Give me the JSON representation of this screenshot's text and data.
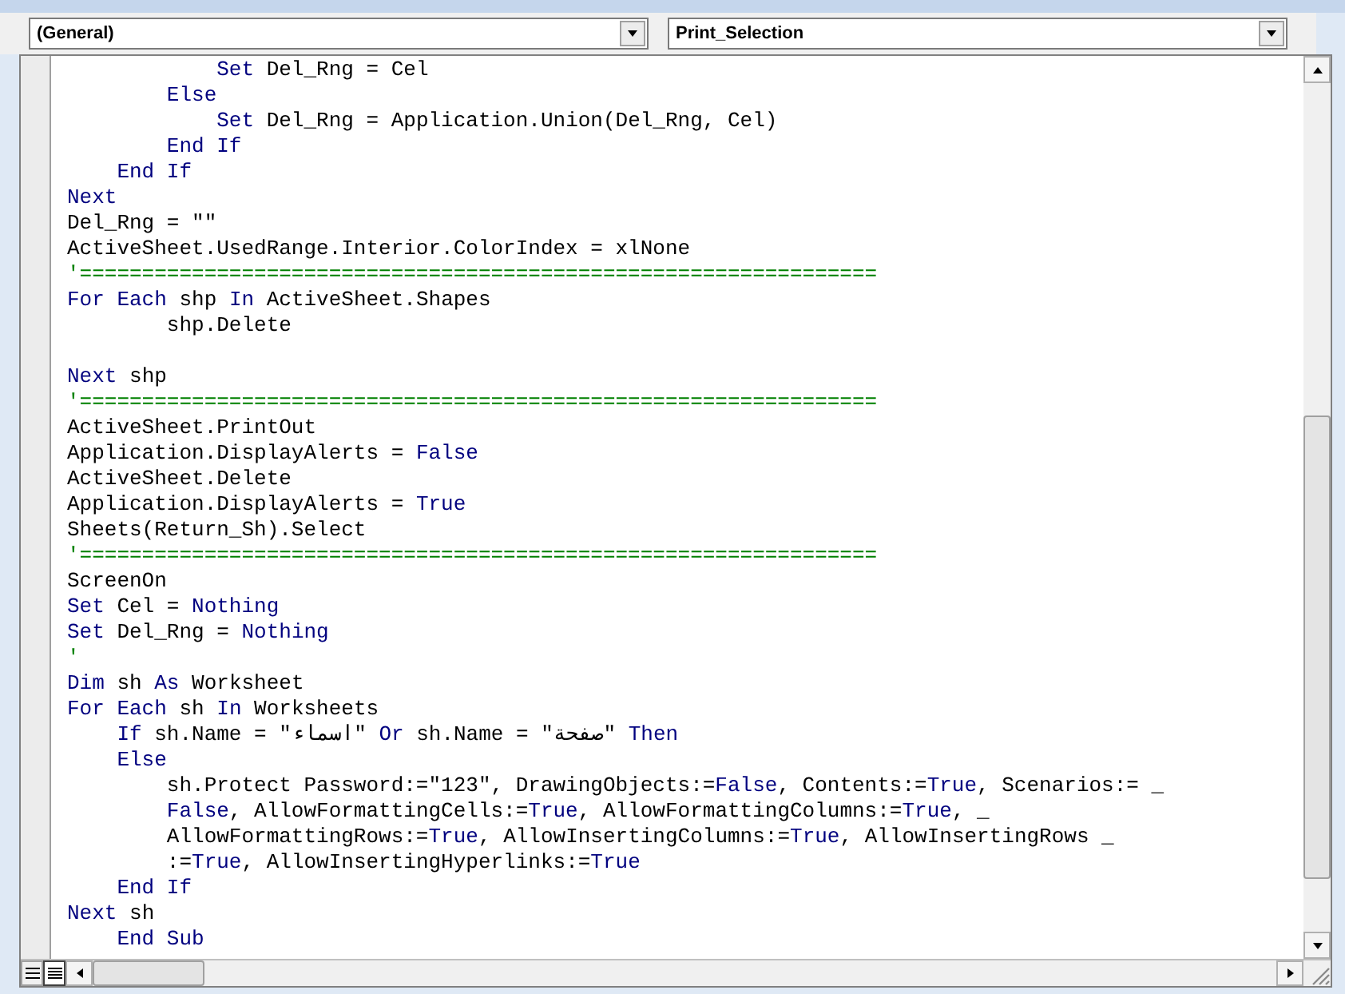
{
  "object_box": {
    "value": "(General)"
  },
  "procedure_box": {
    "value": "Print_Selection"
  },
  "code_lines": [
    {
      "kind": "code",
      "segments": [
        {
          "kind": "keyword",
          "t": "            Set"
        },
        {
          "kind": "text",
          "t": " Del_Rng = Cel"
        }
      ]
    },
    {
      "kind": "code",
      "segments": [
        {
          "kind": "keyword",
          "t": "        Else"
        }
      ]
    },
    {
      "kind": "code",
      "segments": [
        {
          "kind": "keyword",
          "t": "            Set"
        },
        {
          "kind": "text",
          "t": " Del_Rng = Application.Union(Del_Rng, Cel)"
        }
      ]
    },
    {
      "kind": "code",
      "segments": [
        {
          "kind": "keyword",
          "t": "        End If"
        }
      ]
    },
    {
      "kind": "code",
      "segments": [
        {
          "kind": "keyword",
          "t": "    End If"
        }
      ]
    },
    {
      "kind": "code",
      "segments": [
        {
          "kind": "keyword",
          "t": "Next"
        }
      ]
    },
    {
      "kind": "code",
      "segments": [
        {
          "kind": "text",
          "t": "Del_Rng = \"\""
        }
      ]
    },
    {
      "kind": "code",
      "segments": [
        {
          "kind": "text",
          "t": "ActiveSheet.UsedRange.Interior.ColorIndex = xlNone"
        }
      ]
    },
    {
      "kind": "code",
      "segments": [
        {
          "kind": "comment",
          "t": "'================================================================"
        }
      ]
    },
    {
      "kind": "code",
      "segments": [
        {
          "kind": "keyword",
          "t": "For Each"
        },
        {
          "kind": "text",
          "t": " shp "
        },
        {
          "kind": "keyword",
          "t": "In"
        },
        {
          "kind": "text",
          "t": " ActiveSheet.Shapes"
        }
      ]
    },
    {
      "kind": "code",
      "segments": [
        {
          "kind": "text",
          "t": "        shp.Delete"
        }
      ]
    },
    {
      "kind": "blank"
    },
    {
      "kind": "code",
      "segments": [
        {
          "kind": "keyword",
          "t": "Next"
        },
        {
          "kind": "text",
          "t": " shp"
        }
      ]
    },
    {
      "kind": "code",
      "segments": [
        {
          "kind": "comment",
          "t": "'================================================================"
        }
      ]
    },
    {
      "kind": "code",
      "segments": [
        {
          "kind": "text",
          "t": "ActiveSheet.PrintOut"
        }
      ]
    },
    {
      "kind": "code",
      "segments": [
        {
          "kind": "text",
          "t": "Application.DisplayAlerts = "
        },
        {
          "kind": "keyword",
          "t": "False"
        }
      ]
    },
    {
      "kind": "code",
      "segments": [
        {
          "kind": "text",
          "t": "ActiveSheet.Delete"
        }
      ]
    },
    {
      "kind": "code",
      "segments": [
        {
          "kind": "text",
          "t": "Application.DisplayAlerts = "
        },
        {
          "kind": "keyword",
          "t": "True"
        }
      ]
    },
    {
      "kind": "code",
      "segments": [
        {
          "kind": "text",
          "t": "Sheets(Return_Sh).Select"
        }
      ]
    },
    {
      "kind": "code",
      "segments": [
        {
          "kind": "comment",
          "t": "'================================================================"
        }
      ]
    },
    {
      "kind": "code",
      "segments": [
        {
          "kind": "text",
          "t": "ScreenOn"
        }
      ]
    },
    {
      "kind": "code",
      "segments": [
        {
          "kind": "keyword",
          "t": "Set"
        },
        {
          "kind": "text",
          "t": " Cel = "
        },
        {
          "kind": "keyword",
          "t": "Nothing"
        }
      ]
    },
    {
      "kind": "code",
      "segments": [
        {
          "kind": "keyword",
          "t": "Set"
        },
        {
          "kind": "text",
          "t": " Del_Rng = "
        },
        {
          "kind": "keyword",
          "t": "Nothing"
        }
      ]
    },
    {
      "kind": "code",
      "segments": [
        {
          "kind": "comment",
          "t": "'"
        }
      ]
    },
    {
      "kind": "code",
      "segments": [
        {
          "kind": "keyword",
          "t": "Dim"
        },
        {
          "kind": "text",
          "t": " sh "
        },
        {
          "kind": "keyword",
          "t": "As"
        },
        {
          "kind": "text",
          "t": " Worksheet"
        }
      ]
    },
    {
      "kind": "code",
      "segments": [
        {
          "kind": "keyword",
          "t": "For Each"
        },
        {
          "kind": "text",
          "t": " sh "
        },
        {
          "kind": "keyword",
          "t": "In"
        },
        {
          "kind": "text",
          "t": " Worksheets"
        }
      ]
    },
    {
      "kind": "code",
      "segments": [
        {
          "kind": "keyword",
          "t": "    If"
        },
        {
          "kind": "text",
          "t": " sh.Name = \"اسماء\" "
        },
        {
          "kind": "keyword",
          "t": "Or"
        },
        {
          "kind": "text",
          "t": " sh.Name = \"صفحة\" "
        },
        {
          "kind": "keyword",
          "t": "Then"
        }
      ]
    },
    {
      "kind": "code",
      "segments": [
        {
          "kind": "keyword",
          "t": "    Else"
        }
      ]
    },
    {
      "kind": "code",
      "segments": [
        {
          "kind": "text",
          "t": "        sh.Protect Password:=\"123\", DrawingObjects:="
        },
        {
          "kind": "keyword",
          "t": "False"
        },
        {
          "kind": "text",
          "t": ", Contents:="
        },
        {
          "kind": "keyword",
          "t": "True"
        },
        {
          "kind": "text",
          "t": ", Scenarios:= _"
        }
      ]
    },
    {
      "kind": "code",
      "segments": [
        {
          "kind": "keyword",
          "t": "        False"
        },
        {
          "kind": "text",
          "t": ", AllowFormattingCells:="
        },
        {
          "kind": "keyword",
          "t": "True"
        },
        {
          "kind": "text",
          "t": ", AllowFormattingColumns:="
        },
        {
          "kind": "keyword",
          "t": "True"
        },
        {
          "kind": "text",
          "t": ", _"
        }
      ]
    },
    {
      "kind": "code",
      "segments": [
        {
          "kind": "text",
          "t": "        AllowFormattingRows:="
        },
        {
          "kind": "keyword",
          "t": "True"
        },
        {
          "kind": "text",
          "t": ", AllowInsertingColumns:="
        },
        {
          "kind": "keyword",
          "t": "True"
        },
        {
          "kind": "text",
          "t": ", AllowInsertingRows _"
        }
      ]
    },
    {
      "kind": "code",
      "segments": [
        {
          "kind": "text",
          "t": "        :="
        },
        {
          "kind": "keyword",
          "t": "True"
        },
        {
          "kind": "text",
          "t": ", AllowInsertingHyperlinks:="
        },
        {
          "kind": "keyword",
          "t": "True"
        }
      ]
    },
    {
      "kind": "code",
      "segments": [
        {
          "kind": "keyword",
          "t": "    End If"
        }
      ]
    },
    {
      "kind": "code",
      "segments": [
        {
          "kind": "keyword",
          "t": "Next"
        },
        {
          "kind": "text",
          "t": " sh"
        }
      ]
    },
    {
      "kind": "code",
      "segments": [
        {
          "kind": "keyword",
          "t": "    End Sub"
        }
      ]
    }
  ]
}
